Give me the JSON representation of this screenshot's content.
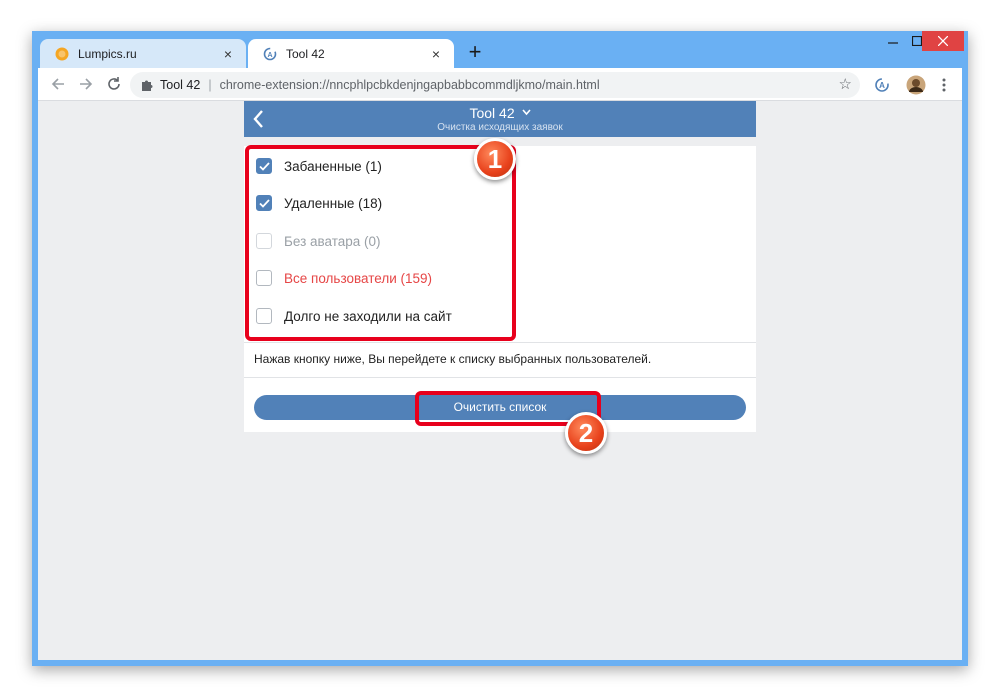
{
  "browser": {
    "tabs": [
      {
        "title": "Lumpics.ru",
        "favicon": "lumpics-orange-circle"
      },
      {
        "title": "Tool 42",
        "favicon": "tool42-icon"
      }
    ],
    "new_tab": "+",
    "close_glyph": "×",
    "omnibox": {
      "ext_name": "Tool 42",
      "url": "chrome-extension://nncphlpcbkdenjngapbabbcommdljkmo/main.html"
    }
  },
  "app": {
    "header": {
      "title": "Tool 42",
      "subtitle": "Очистка исходящих заявок"
    },
    "options": [
      {
        "label": "Забаненные (1)",
        "checked": true,
        "state": "normal"
      },
      {
        "label": "Удаленные (18)",
        "checked": true,
        "state": "normal"
      },
      {
        "label": "Без аватара (0)",
        "checked": false,
        "state": "disabled"
      },
      {
        "label": "Все пользователи (159)",
        "checked": false,
        "state": "danger"
      },
      {
        "label": "Долго не заходили на сайт",
        "checked": false,
        "state": "normal"
      }
    ],
    "hint": "Нажав кнопку ниже, Вы перейдете к списку выбранных пользователей.",
    "button_label": "Очистить список"
  },
  "annotations": {
    "marker_1": "1",
    "marker_2": "2"
  },
  "colors": {
    "accent": "#5181b8",
    "danger": "#e64646",
    "annotation": "#e8001c"
  }
}
